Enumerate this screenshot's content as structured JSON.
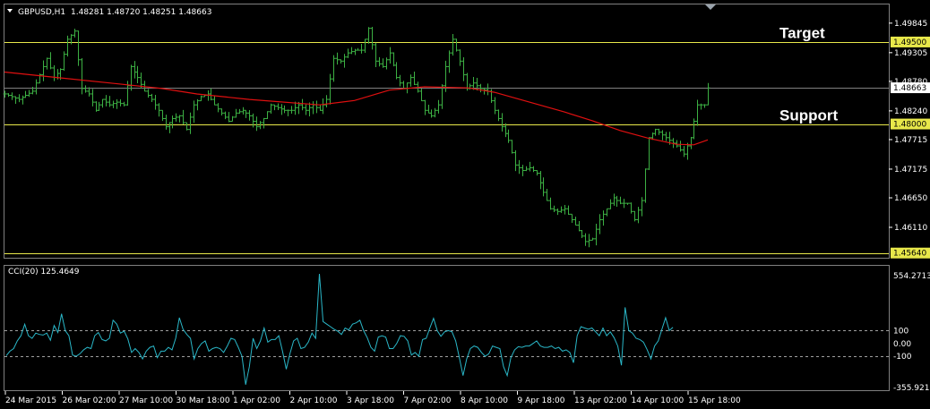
{
  "header": {
    "symbol": "GBPUSD,H1",
    "ohlc": "1.48281 1.48720 1.48251 1.48663",
    "indicator_title": "CCI(20) 125.4649"
  },
  "colors": {
    "background": "#000000",
    "candles": "#3cb043",
    "ma": "#e01010",
    "levels": "#e8e84a",
    "cci": "#2ab7c8",
    "grid_line": "#808080"
  },
  "chart_data": [
    {
      "type": "line",
      "title": "GBPUSD,H1",
      "price_axis_ticks": [
        "1.49845",
        "1.49305",
        "1.48780",
        "1.48240",
        "1.47715",
        "1.47175",
        "1.46650",
        "1.46110"
      ],
      "ylim": [
        1.4557,
        1.5017
      ],
      "x_labels": [
        "24 Mar 2015",
        "26 Mar 02:00",
        "27 Mar 10:00",
        "30 Mar 18:00",
        "1 Apr 02:00",
        "2 Apr 10:00",
        "3 Apr 18:00",
        "7 Apr 02:00",
        "8 Apr 10:00",
        "9 Apr 18:00",
        "13 Apr 02:00",
        "14 Apr 10:00",
        "15 Apr 18:00"
      ],
      "levels": [
        {
          "label": "1.49500",
          "value": 1.495,
          "annotation": "Target"
        },
        {
          "label": "1.48000",
          "value": 1.48,
          "annotation": "Support"
        },
        {
          "label": "1.48663",
          "value": 1.48663,
          "annotation": ""
        },
        {
          "label": "1.45640",
          "value": 1.4564,
          "annotation": ""
        }
      ],
      "close_path": [
        [
          0,
          1.4855
        ],
        [
          8,
          1.4845
        ],
        [
          16,
          1.486
        ],
        [
          20,
          1.489
        ],
        [
          24,
          1.492
        ],
        [
          28,
          1.4885
        ],
        [
          32,
          1.49
        ],
        [
          36,
          1.4955
        ],
        [
          40,
          1.497
        ],
        [
          44,
          1.4865
        ],
        [
          48,
          1.4855
        ],
        [
          52,
          1.4825
        ],
        [
          56,
          1.4845
        ],
        [
          60,
          1.4835
        ],
        [
          64,
          1.484
        ],
        [
          68,
          1.4835
        ],
        [
          72,
          1.4905
        ],
        [
          76,
          1.4885
        ],
        [
          80,
          1.486
        ],
        [
          84,
          1.4845
        ],
        [
          88,
          1.4825
        ],
        [
          92,
          1.4795
        ],
        [
          96,
          1.481
        ],
        [
          100,
          1.4815
        ],
        [
          104,
          1.479
        ],
        [
          108,
          1.4835
        ],
        [
          112,
          1.485
        ],
        [
          116,
          1.4855
        ],
        [
          120,
          1.4835
        ],
        [
          124,
          1.482
        ],
        [
          128,
          1.4805
        ],
        [
          132,
          1.482
        ],
        [
          136,
          1.4825
        ],
        [
          140,
          1.4815
        ],
        [
          144,
          1.4795
        ],
        [
          148,
          1.481
        ],
        [
          152,
          1.4835
        ],
        [
          156,
          1.483
        ],
        [
          160,
          1.4825
        ],
        [
          164,
          1.4825
        ],
        [
          168,
          1.4835
        ],
        [
          172,
          1.4825
        ],
        [
          176,
          1.4835
        ],
        [
          180,
          1.4825
        ],
        [
          184,
          1.4845
        ],
        [
          188,
          1.492
        ],
        [
          192,
          1.4915
        ],
        [
          196,
          1.493
        ],
        [
          200,
          1.4935
        ],
        [
          204,
          1.4935
        ],
        [
          208,
          1.4975
        ],
        [
          212,
          1.4915
        ],
        [
          216,
          1.4905
        ],
        [
          220,
          1.493
        ],
        [
          224,
          1.4885
        ],
        [
          228,
          1.4865
        ],
        [
          232,
          1.4885
        ],
        [
          236,
          1.486
        ],
        [
          240,
          1.4825
        ],
        [
          244,
          1.4815
        ],
        [
          248,
          1.4835
        ],
        [
          252,
          1.4905
        ],
        [
          256,
          1.4955
        ],
        [
          260,
          1.4915
        ],
        [
          264,
          1.4865
        ],
        [
          268,
          1.4875
        ],
        [
          272,
          1.4865
        ],
        [
          276,
          1.486
        ],
        [
          280,
          1.4825
        ],
        [
          284,
          1.4795
        ],
        [
          288,
          1.477
        ],
        [
          292,
          1.4725
        ],
        [
          296,
          1.4715
        ],
        [
          300,
          1.472
        ],
        [
          304,
          1.471
        ],
        [
          308,
          1.4675
        ],
        [
          312,
          1.4645
        ],
        [
          316,
          1.464
        ],
        [
          320,
          1.4645
        ],
        [
          324,
          1.4625
        ],
        [
          328,
          1.4605
        ],
        [
          332,
          1.4585
        ],
        [
          336,
          1.459
        ],
        [
          340,
          1.4625
        ],
        [
          344,
          1.4645
        ],
        [
          348,
          1.4665
        ],
        [
          352,
          1.4655
        ],
        [
          356,
          1.4655
        ],
        [
          360,
          1.4625
        ],
        [
          364,
          1.466
        ],
        [
          368,
          1.4775
        ],
        [
          372,
          1.479
        ],
        [
          376,
          1.478
        ],
        [
          380,
          1.477
        ],
        [
          384,
          1.476
        ],
        [
          388,
          1.4745
        ],
        [
          392,
          1.4775
        ],
        [
          396,
          1.4835
        ],
        [
          400,
          1.4835
        ],
        [
          402,
          1.4866
        ]
      ],
      "ma_path": [
        [
          0,
          1.4895
        ],
        [
          30,
          1.4885
        ],
        [
          60,
          1.4875
        ],
        [
          90,
          1.4865
        ],
        [
          110,
          1.4855
        ],
        [
          140,
          1.4845
        ],
        [
          180,
          1.4835
        ],
        [
          200,
          1.4843
        ],
        [
          220,
          1.4862
        ],
        [
          240,
          1.4868
        ],
        [
          265,
          1.4866
        ],
        [
          280,
          1.4858
        ],
        [
          300,
          1.484
        ],
        [
          320,
          1.4822
        ],
        [
          336,
          1.4806
        ],
        [
          352,
          1.4788
        ],
        [
          368,
          1.4774
        ],
        [
          384,
          1.4763
        ],
        [
          394,
          1.4762
        ],
        [
          402,
          1.4771
        ]
      ]
    },
    {
      "type": "line",
      "title": "CCI(20) 125.4649",
      "axis_ticks": [
        "554.2713",
        "100",
        "0.00",
        "-100",
        "-355.9219"
      ],
      "ylim": [
        -356,
        554
      ],
      "series": [
        {
          "values": [
            -95,
            -60,
            -40,
            20,
            60,
            150,
            60,
            40,
            80,
            70,
            65,
            80,
            25,
            140,
            85,
            230,
            100,
            60,
            -90,
            -100,
            -80,
            -50,
            -30,
            -40,
            60,
            85,
            30,
            20,
            40,
            180,
            150,
            80,
            95,
            35,
            -70,
            -40,
            -70,
            -120,
            -60,
            -30,
            -20,
            -110,
            -60,
            -60,
            -30,
            -50,
            40,
            200,
            110,
            70,
            40,
            -120,
            -40,
            0,
            20,
            -60,
            -40,
            -30,
            -40,
            -70,
            -20,
            40,
            30,
            -30,
            -100,
            -320,
            -180,
            40,
            -40,
            20,
            120,
            10,
            30,
            30,
            60,
            -60,
            -200,
            -80,
            20,
            40,
            -40,
            -30,
            10,
            80,
            40,
            540,
            170,
            150,
            130,
            110,
            95,
            70,
            120,
            105,
            150,
            160,
            180,
            100,
            45,
            -30,
            -60,
            50,
            60,
            50,
            -40,
            -40,
            0,
            60,
            55,
            20,
            -90,
            -70,
            -100,
            30,
            40,
            120,
            195,
            100,
            55,
            90,
            100,
            90,
            20,
            -110,
            -250,
            -120,
            -40,
            -20,
            -30,
            -70,
            -100,
            -80,
            -20,
            -30,
            -40,
            -180,
            -250,
            -110,
            -50,
            -25,
            -30,
            -20,
            -20,
            0,
            20,
            -20,
            -30,
            -30,
            -20,
            -40,
            -30,
            -60,
            -50,
            -70,
            -150,
            60,
            130,
            120,
            110,
            120,
            90,
            60,
            120,
            60,
            90,
            45,
            -20,
            -170,
            280,
            100,
            80,
            40,
            30,
            10,
            -50,
            -120,
            -20,
            20,
            110,
            200,
            100,
            125
          ]
        }
      ]
    }
  ]
}
